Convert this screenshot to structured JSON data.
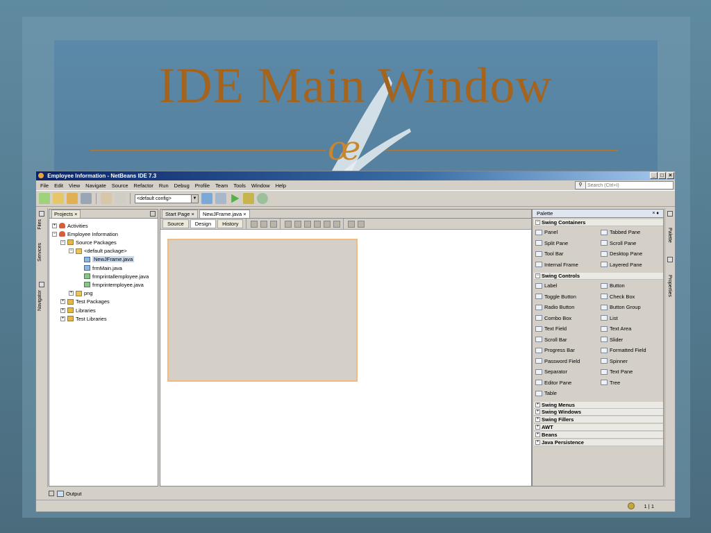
{
  "slide": {
    "title": "IDE Main Window",
    "ornament": "œ"
  },
  "window": {
    "title": "Employee Information - NetBeans IDE 7.3",
    "controls": {
      "minimize": "_",
      "maximize": "□",
      "close": "×"
    }
  },
  "menu": [
    "File",
    "Edit",
    "View",
    "Navigate",
    "Source",
    "Refactor",
    "Run",
    "Debug",
    "Profile",
    "Team",
    "Tools",
    "Window",
    "Help"
  ],
  "search": {
    "placeholder": "Search (Ctrl+I)"
  },
  "toolbar": {
    "config_value": "<default config>"
  },
  "left_strip": {
    "files": "Files",
    "services": "Services",
    "navigator": "Navigator"
  },
  "projects": {
    "tab_label": "Projects",
    "tree": [
      {
        "label": "Activities",
        "exp": "+",
        "icon": "project",
        "depth": 0
      },
      {
        "label": "Employee Information",
        "exp": "−",
        "icon": "project",
        "depth": 0
      },
      {
        "label": "Source Packages",
        "exp": "−",
        "icon": "folder",
        "depth": 1
      },
      {
        "label": "<default package>",
        "exp": "−",
        "icon": "package",
        "depth": 2
      },
      {
        "label": "NewJFrame.java",
        "exp": "",
        "icon": "java",
        "depth": 3,
        "selected": true
      },
      {
        "label": "frmMain.java",
        "exp": "",
        "icon": "java",
        "depth": 3
      },
      {
        "label": "frmprintallemployee.java",
        "exp": "",
        "icon": "java2",
        "depth": 3
      },
      {
        "label": "frmprintemployee.java",
        "exp": "",
        "icon": "java2",
        "depth": 3
      },
      {
        "label": "png",
        "exp": "+",
        "icon": "package",
        "depth": 2
      },
      {
        "label": "Test Packages",
        "exp": "+",
        "icon": "folder",
        "depth": 1
      },
      {
        "label": "Libraries",
        "exp": "+",
        "icon": "folder",
        "depth": 1
      },
      {
        "label": "Test Libraries",
        "exp": "+",
        "icon": "folder",
        "depth": 1
      }
    ]
  },
  "editor": {
    "tabs": [
      {
        "label": "Start Page",
        "close": "×"
      },
      {
        "label": "NewJFrame.java",
        "close": "×",
        "active": true
      }
    ],
    "view_tabs": [
      {
        "label": "Source"
      },
      {
        "label": "Design",
        "active": true
      },
      {
        "label": "History"
      }
    ]
  },
  "palette": {
    "title": "Palette",
    "head_controls": "×  ♦",
    "categories": [
      {
        "label": "Swing Containers",
        "expanded": true,
        "items": [
          "Panel",
          "Tabbed Pane",
          "Split Pane",
          "Scroll Pane",
          "Tool Bar",
          "Desktop Pane",
          "Internal Frame",
          "Layered Pane"
        ]
      },
      {
        "label": "Swing Controls",
        "expanded": true,
        "items": [
          "Label",
          "Button",
          "Toggle Button",
          "Check Box",
          "Radio Button",
          "Button Group",
          "Combo Box",
          "List",
          "Text Field",
          "Text Area",
          "Scroll Bar",
          "Slider",
          "Progress Bar",
          "Formatted Field",
          "Password Field",
          "Spinner",
          "Separator",
          "Text Pane",
          "Editor Pane",
          "Tree",
          "Table"
        ]
      },
      {
        "label": "Swing Menus",
        "expanded": false
      },
      {
        "label": "Swing Windows",
        "expanded": false
      },
      {
        "label": "Swing Fillers",
        "expanded": false
      },
      {
        "label": "AWT",
        "expanded": false
      },
      {
        "label": "Beans",
        "expanded": false
      },
      {
        "label": "Java Persistence",
        "expanded": false
      }
    ]
  },
  "right_strip": {
    "palette": "Palette",
    "properties": "Properties"
  },
  "output": {
    "label": "Output"
  },
  "status": {
    "position": "1 | 1"
  },
  "colors": {
    "title_color": "#a4641d",
    "titlebar": "#0a246a",
    "selection": "#c8d8ec"
  }
}
